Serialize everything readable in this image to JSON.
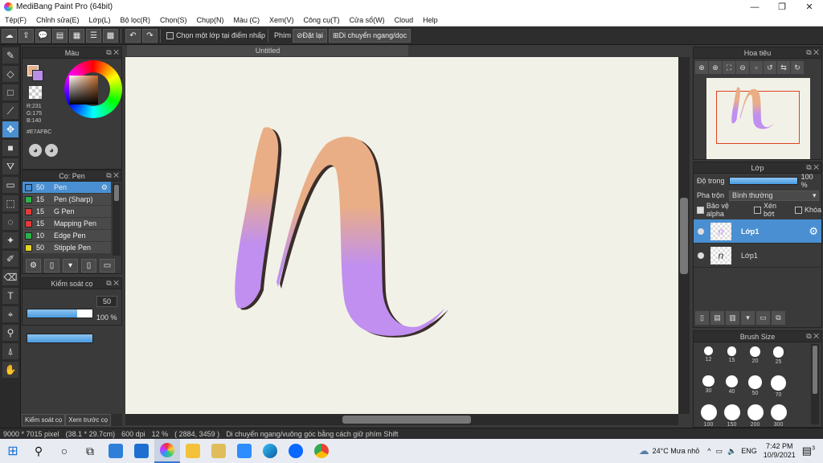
{
  "window": {
    "title": "MediBang Paint Pro (64bit)",
    "controls": [
      "—",
      "❐",
      "✕"
    ]
  },
  "menu": [
    "Tệp(F)",
    "Chỉnh sửa(E)",
    "Lớp(L)",
    "Bộ lọc(R)",
    "Chọn(S)",
    "Chụp(N)",
    "Màu (C)",
    "Xem(V)",
    "Công cụ(T)",
    "Cửa sổ(W)",
    "Cloud",
    "Help"
  ],
  "toolbar": {
    "select_layer_label": "Chọn một lớp tại điểm nhấp",
    "snap_label": "Phím",
    "reset_label": "Đặt lại",
    "move_label": "Di chuyển ngang/dọc"
  },
  "color_panel": {
    "title": "Màu",
    "r": "R:231",
    "g": "G:175",
    "b": "B:140",
    "hex": "#E7AFBC",
    "fg_color": "#e7af8c",
    "bg_color": "#b88ee8"
  },
  "brush_panel": {
    "title": "Cọ: Pen",
    "brushes": [
      {
        "size": "50",
        "name": "Pen",
        "color": "#4a8fd1",
        "selected": true
      },
      {
        "size": "15",
        "name": "Pen (Sharp)",
        "color": "#2bb24a"
      },
      {
        "size": "15",
        "name": "G Pen",
        "color": "#e23b3b"
      },
      {
        "size": "15",
        "name": "Mapping Pen",
        "color": "#e23b3b"
      },
      {
        "size": "10",
        "name": "Edge Pen",
        "color": "#2bb24a"
      },
      {
        "size": "50",
        "name": "Stipple Pen",
        "color": "#e6d22b"
      }
    ]
  },
  "brush_control": {
    "title": "Kiểm soát cọ",
    "size_value": "50",
    "size_fill": 0.76,
    "opacity_value": "100 %",
    "opacity_fill": 1.0
  },
  "left_tabs": [
    "Kiểm soát cọ",
    "Xem trước cọ"
  ],
  "canvas": {
    "tab_title": "Untitled",
    "top_color": "#e9ae86",
    "bottom_color": "#c08ff0",
    "outline_color": "#3a2e2a"
  },
  "navigator": {
    "title": "Hoa tiêu"
  },
  "layers": {
    "title": "Lớp",
    "opacity_label": "Độ trong",
    "opacity_value": "100 %",
    "opacity_fill": 1.0,
    "blend_label": "Pha trộn",
    "blend_value": "Bình thường",
    "protect_alpha": "Bảo vệ alpha",
    "clip": "Xén bớt",
    "lock": "Khóa",
    "items": [
      {
        "name": "Lớp1",
        "selected": true
      },
      {
        "name": "Lớp1",
        "selected": false
      }
    ]
  },
  "brush_size": {
    "title": "Brush Size",
    "sizes": [
      "12",
      "15",
      "20",
      "25",
      "30",
      "40",
      "50",
      "70",
      "100",
      "150",
      "200",
      "300"
    ]
  },
  "status": {
    "dimensions": "9000 * 7015 pixel",
    "cm": "(38.1 * 29.7cm)",
    "dpi": "600 dpi",
    "zoom": "12 %",
    "coords": "( 2884, 3459 )",
    "hint": "Di chuyển ngang/vuông góc bằng cách giữ phím Shift"
  },
  "taskbar": {
    "weather": "24°C  Mưa nhỏ",
    "lang": "ENG",
    "time": "7:42 PM",
    "date": "10/9/2021",
    "notifications": "3"
  }
}
